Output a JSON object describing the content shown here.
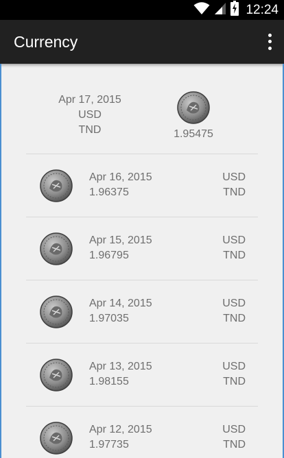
{
  "status_bar": {
    "time": "12:24",
    "icons": [
      "wifi-icon",
      "signal-icon",
      "battery-charging-icon"
    ]
  },
  "app_bar": {
    "title": "Currency",
    "menu_icon": "more-vertical-icon",
    "background": "#212121"
  },
  "featured": {
    "date": "Apr 17, 2015",
    "from": "USD",
    "to": "TND",
    "rate": "1.95475",
    "icon": "coin-icon"
  },
  "rows": [
    {
      "date": "Apr 16, 2015",
      "rate": "1.96375",
      "from": "USD",
      "to": "TND",
      "icon": "coin-icon"
    },
    {
      "date": "Apr 15, 2015",
      "rate": "1.96795",
      "from": "USD",
      "to": "TND",
      "icon": "coin-icon"
    },
    {
      "date": "Apr 14, 2015",
      "rate": "1.97035",
      "from": "USD",
      "to": "TND",
      "icon": "coin-icon"
    },
    {
      "date": "Apr 13, 2015",
      "rate": "1.98155",
      "from": "USD",
      "to": "TND",
      "icon": "coin-icon"
    },
    {
      "date": "Apr 12, 2015",
      "rate": "1.97735",
      "from": "USD",
      "to": "TND",
      "icon": "coin-icon"
    }
  ],
  "colors": {
    "text": "#6e6e6e",
    "divider": "#d9d9d9",
    "background": "#f0f0f0",
    "edge_accent": "#4a8fd1"
  }
}
